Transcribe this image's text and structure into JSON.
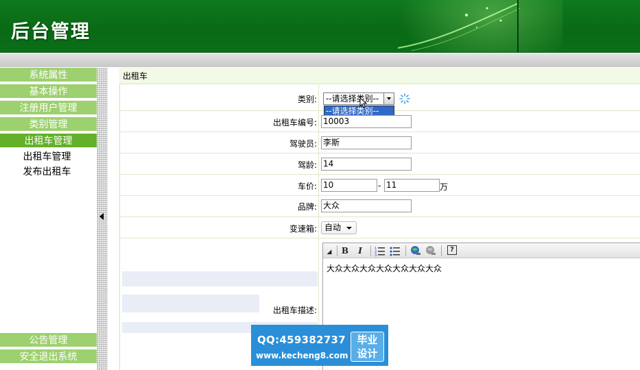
{
  "header": {
    "title": "后台管理"
  },
  "sidebar": {
    "items": [
      {
        "label": "系统属性"
      },
      {
        "label": "基本操作"
      },
      {
        "label": "注册用户管理"
      },
      {
        "label": "类别管理"
      },
      {
        "label": "出租车管理",
        "active": true
      }
    ],
    "subitems": [
      {
        "label": "出租车管理"
      },
      {
        "label": "发布出租车"
      }
    ],
    "bottom_items": [
      {
        "label": "公告管理"
      },
      {
        "label": "安全退出系统"
      }
    ]
  },
  "breadcrumb": "出租车",
  "form": {
    "category": {
      "label": "类别:",
      "selected": "--请选择类别--",
      "options": [
        "--请选择类别--"
      ]
    },
    "taxi_no": {
      "label": "出租车编号:",
      "value": "10003"
    },
    "driver": {
      "label": "驾驶员:",
      "value": "李斯"
    },
    "driving_years": {
      "label": "驾龄:",
      "value": "14"
    },
    "price": {
      "label": "车价:",
      "min": "10",
      "separator": "-",
      "max": "11",
      "unit": "万"
    },
    "brand": {
      "label": "品牌:",
      "value": "大众"
    },
    "gearbox": {
      "label": "变速箱:",
      "selected": "自动"
    },
    "description": {
      "label": "出租车描述:",
      "content": "大众大众大众大众大众大众大众"
    }
  },
  "editor_toolbar": {
    "icons": [
      "expand-icon",
      "bold-icon",
      "italic-icon",
      "ordered-list-icon",
      "unordered-list-icon",
      "link-icon",
      "unlink-icon",
      "help-icon"
    ],
    "bold": "B",
    "italic": "I",
    "help": "?"
  },
  "watermark": {
    "qq": "QQ:459382737",
    "url": "www.kecheng8.com",
    "badge_line1": "毕业",
    "badge_line2": "设计"
  },
  "colors": {
    "header_green": "#0b6e18",
    "sidebar_button": "#9dd06f",
    "sidebar_active": "#64b02a",
    "watermark_blue": "#2a8fd8"
  }
}
